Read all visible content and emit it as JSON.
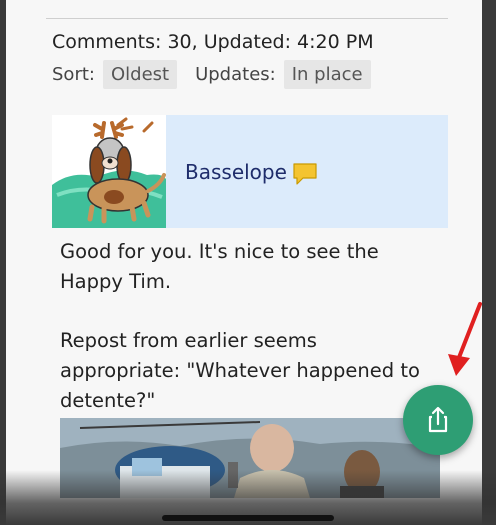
{
  "meta": {
    "comments_label": "Comments:",
    "comments_count": "30,",
    "updated_label": "Updated:",
    "updated_time": "4:20 PM"
  },
  "sort": {
    "label": "Sort:",
    "value": "Oldest"
  },
  "updates": {
    "label": "Updates:",
    "value": "In place"
  },
  "comment": {
    "username": "Basselope",
    "avatar_icon": "basselope-avatar-icon",
    "message_icon": "speech-bubble-icon",
    "paragraphs": [
      "Good for you. It's nice to see the Happy Tim.",
      "Repost from earlier seems appropriate: \"Whatever happened to detente?\""
    ]
  },
  "share_button": {
    "icon": "share-icon",
    "color": "#2e9e74"
  },
  "annotation": {
    "arrow_color": "#e02020"
  }
}
